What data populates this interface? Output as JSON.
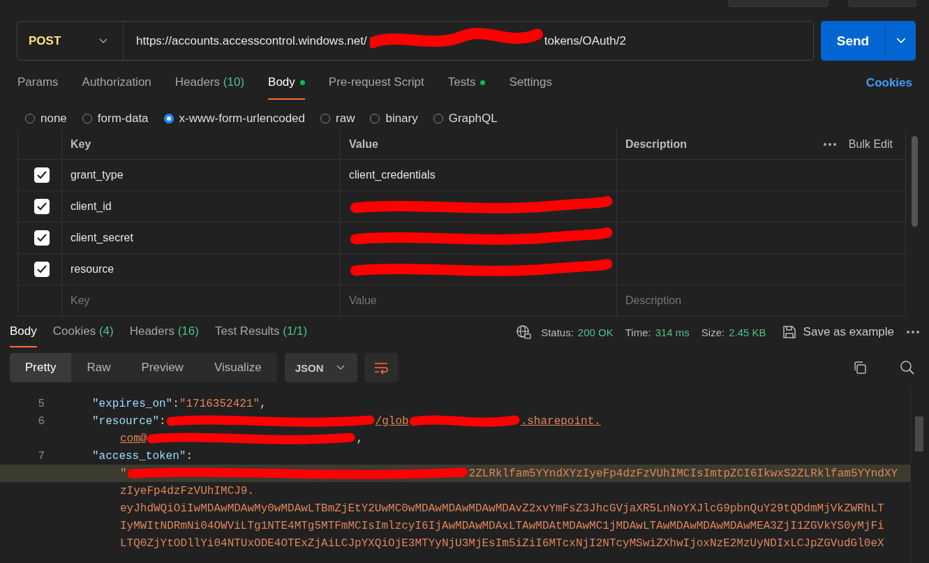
{
  "request": {
    "method": "POST",
    "url_start": "https://accounts.accesscontrol.windows.net/",
    "url_end": "tokens/OAuth/2",
    "send": "Send"
  },
  "request_tabs": [
    {
      "label": "Params",
      "selected": false,
      "dot": false
    },
    {
      "label": "Authorization",
      "selected": false,
      "dot": false
    },
    {
      "label": "Headers",
      "count": "(10)",
      "selected": false,
      "dot": false
    },
    {
      "label": "Body",
      "selected": true,
      "dot": true
    },
    {
      "label": "Pre-request Script",
      "selected": false,
      "dot": false
    },
    {
      "label": "Tests",
      "selected": false,
      "dot": true
    },
    {
      "label": "Settings",
      "selected": false,
      "dot": false
    }
  ],
  "cookies_link": "Cookies",
  "body_types": [
    {
      "label": "none",
      "selected": false
    },
    {
      "label": "form-data",
      "selected": false
    },
    {
      "label": "x-www-form-urlencoded",
      "selected": true
    },
    {
      "label": "raw",
      "selected": false
    },
    {
      "label": "binary",
      "selected": false
    },
    {
      "label": "GraphQL",
      "selected": false
    }
  ],
  "table": {
    "columns": [
      "Key",
      "Value",
      "Description"
    ],
    "bulk_edit": "Bulk Edit",
    "rows": [
      {
        "key": "grant_type",
        "kind": "text",
        "value": "client_credentials",
        "checked": true
      },
      {
        "key": "client_id",
        "kind": "redacted",
        "checked": true
      },
      {
        "key": "client_secret",
        "kind": "redacted",
        "checked": true
      },
      {
        "key": "resource",
        "kind": "redacted",
        "checked": true
      }
    ],
    "placeholder": {
      "key": "Key",
      "value": "Value",
      "description": "Description"
    }
  },
  "response_tabs": [
    {
      "label": "Body",
      "selected": true
    },
    {
      "label": "Cookies",
      "count": "(4)",
      "selected": false
    },
    {
      "label": "Headers",
      "count": "(16)",
      "selected": false
    },
    {
      "label": "Test Results",
      "count": "(1/1)",
      "selected": false
    }
  ],
  "status": {
    "status_label": "Status:",
    "status": "200 OK",
    "time_label": "Time:",
    "time": "314 ms",
    "size_label": "Size:",
    "size": "2.45 KB",
    "save": "Save as example"
  },
  "view_tabs": [
    {
      "label": "Pretty",
      "selected": true
    },
    {
      "label": "Raw",
      "selected": false
    },
    {
      "label": "Preview",
      "selected": false
    },
    {
      "label": "Visualize",
      "selected": false
    }
  ],
  "format": "JSON",
  "code_lines": [
    {
      "number": "5",
      "kind": "line",
      "highlighted": false,
      "parts": [
        {
          "kind": "key",
          "text": "\"expires_on\""
        },
        {
          "kind": "punct",
          "text": ": "
        },
        {
          "kind": "string",
          "text": "\"1716352421\""
        },
        {
          "kind": "punct",
          "text": ","
        }
      ]
    },
    {
      "number": "6",
      "kind": "line",
      "highlighted": false,
      "parts": [
        {
          "kind": "key",
          "text": "\"resource\""
        },
        {
          "kind": "punct",
          "text": ": "
        },
        {
          "kind": "redacted"
        },
        {
          "kind": "link",
          "text": "/glob"
        },
        {
          "kind": "redacted"
        },
        {
          "kind": "link",
          "text": ".sharepoint."
        }
      ]
    },
    {
      "kind": "continuation",
      "highlighted": false,
      "parts": [
        {
          "kind": "link",
          "text": "com@"
        },
        {
          "kind": "redacted"
        },
        {
          "kind": "punct",
          "text": ","
        }
      ]
    },
    {
      "number": "7",
      "kind": "line",
      "highlighted": false,
      "parts": [
        {
          "kind": "key",
          "text": "\"access_token\""
        },
        {
          "kind": "punct",
          "text": ":"
        }
      ]
    },
    {
      "kind": "continuation",
      "highlighted": true,
      "parts": [
        {
          "kind": "string",
          "text": "\""
        },
        {
          "kind": "redacted"
        },
        {
          "kind": "string",
          "text": "2ZLRklfam5YYndXYzIyeFp4dzFzVUhIMCIsImtpZCI6IkwxS2ZLRklfam5YYndXY"
        }
      ]
    },
    {
      "kind": "continuation",
      "highlighted": false,
      "parts": [
        {
          "kind": "string",
          "text": "zIyeFp4dzFzVUhIMCJ9."
        }
      ]
    },
    {
      "kind": "continuation",
      "highlighted": false,
      "parts": [
        {
          "kind": "string",
          "text": "eyJhdWQiOiIwMDAwMDAwMy0wMDAwLTBmZjEtY2UwMC0wMDAwMDAwMDAwMDAvZ2xvYmFsZ3JhcGVjaXR5LnNoYXJlcG9pbnQuY29tQDdmMjVkZWRhLT"
        }
      ]
    },
    {
      "kind": "continuation",
      "highlighted": false,
      "parts": [
        {
          "kind": "string",
          "text": "IyMWItNDRmNi04OWViLTg1NTE4MTg5MTFmMCIsImlzcyI6IjAwMDAwMDAxLTAwMDAtMDAwMC1jMDAwLTAwMDAwMDAwMDAwMEA3ZjI1ZGVkYS0yMjFi"
        }
      ]
    },
    {
      "kind": "continuation",
      "highlighted": false,
      "parts": [
        {
          "kind": "string",
          "text": "LTQ0ZjYtODllYi04NTUxODE4OTExZjAiLCJpYXQiOjE3MTYyNjU3MjEsIm5iZiI6MTcxNjI2NTcyMSwiZXhwIjoxNzE2MzUyNDIxLCJpZGVudGl0eX"
        }
      ]
    }
  ]
}
